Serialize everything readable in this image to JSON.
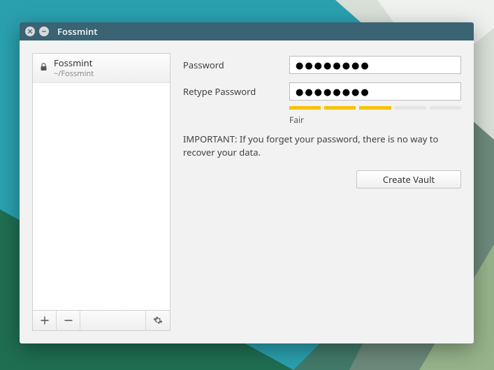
{
  "window": {
    "title": "Fossmint"
  },
  "sidebar": {
    "vault": {
      "name": "Fossmint",
      "path": "~/Fossmint"
    }
  },
  "form": {
    "password_label": "Password",
    "retype_label": "Retype Password",
    "password_value": "●●●●●●●●",
    "retype_value": "●●●●●●●●",
    "strength_label": "Fair",
    "warning": "IMPORTANT: If you forget your password, there is no way to recover your data.",
    "create_button": "Create Vault",
    "strength_segments_on": 3,
    "strength_segments_total": 5
  },
  "icons": {
    "lock": "lock-icon",
    "add": "plus-icon",
    "remove": "minus-icon",
    "settings": "gear-icon",
    "close": "close-icon",
    "minimize": "minimize-icon"
  }
}
